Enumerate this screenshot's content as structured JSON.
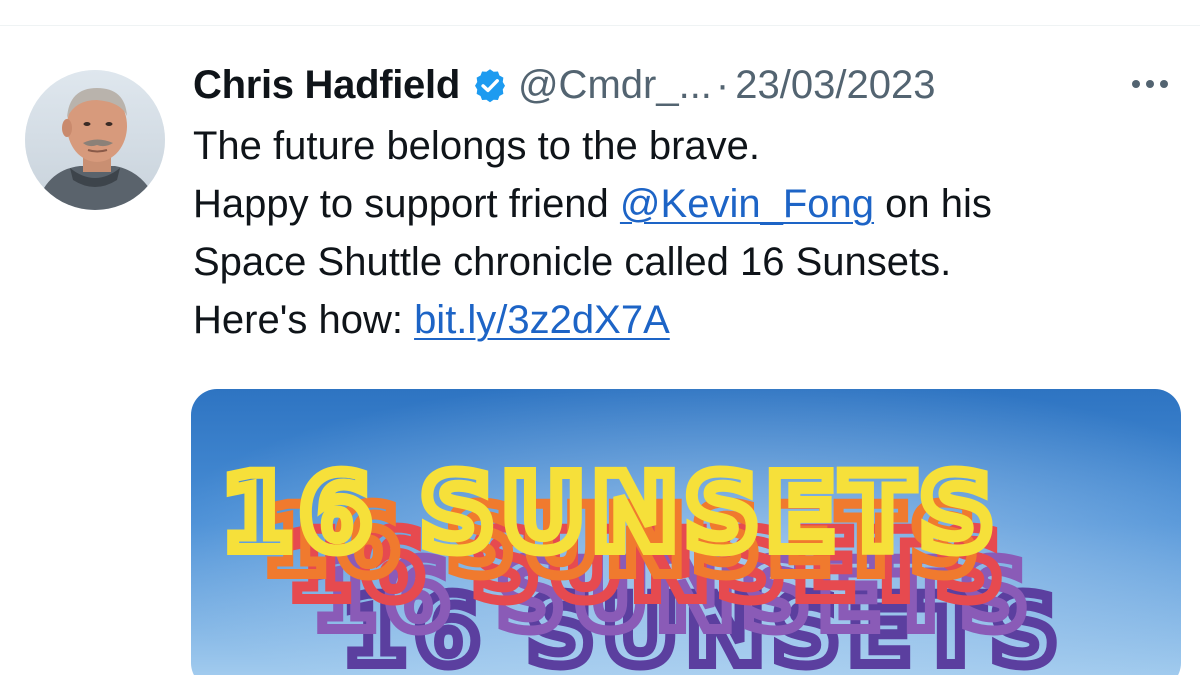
{
  "tweet": {
    "author_name": "Chris Hadfield",
    "verified_icon": "verified-badge-icon",
    "handle": "@Cmdr_...",
    "separator": "·",
    "date": "23/03/2023",
    "more_icon": "more-horizontal-icon",
    "text": {
      "line1": "The future belongs to the brave.",
      "line2_prefix": "Happy to support friend ",
      "mention": "@Kevin_Fong",
      "line2_suffix": " on his",
      "line3": "Space Shuttle chronicle called 16 Sunsets.",
      "line4_prefix": "Here's how: ",
      "url": "bit.ly/3z2dX7A"
    },
    "media": {
      "title_text": "16 SUNSETS",
      "colors": {
        "sky_top": "#2f79c6",
        "sky_bottom": "#9fc9ef",
        "yellow": "#f6e03a",
        "orange": "#f07a2e",
        "red": "#e64a4f",
        "purple": "#8a5bb7",
        "violet": "#5b3f9f"
      }
    }
  },
  "colors": {
    "text_primary": "#0f1419",
    "text_secondary": "#536471",
    "link": "#1d64c6",
    "verified": "#1d9bf0"
  }
}
